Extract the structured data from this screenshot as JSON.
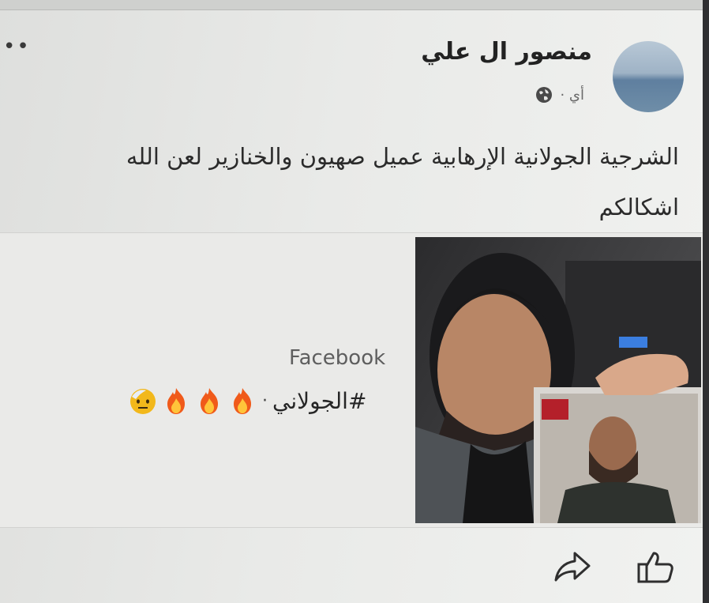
{
  "post": {
    "author": "منصور ال علي",
    "time": "أي ·",
    "text_line1": "الشرجية الجولانية الإرهابية عميل صهيون والخنازير لعن الله",
    "text_line2": "اشكالكم"
  },
  "link_card": {
    "source": "Facebook",
    "hashtag": "#الجولاني",
    "separator": "·"
  },
  "icons": [
    "more-icon",
    "globe-icon",
    "fire-icon",
    "face-icon",
    "share-icon",
    "like-icon"
  ]
}
